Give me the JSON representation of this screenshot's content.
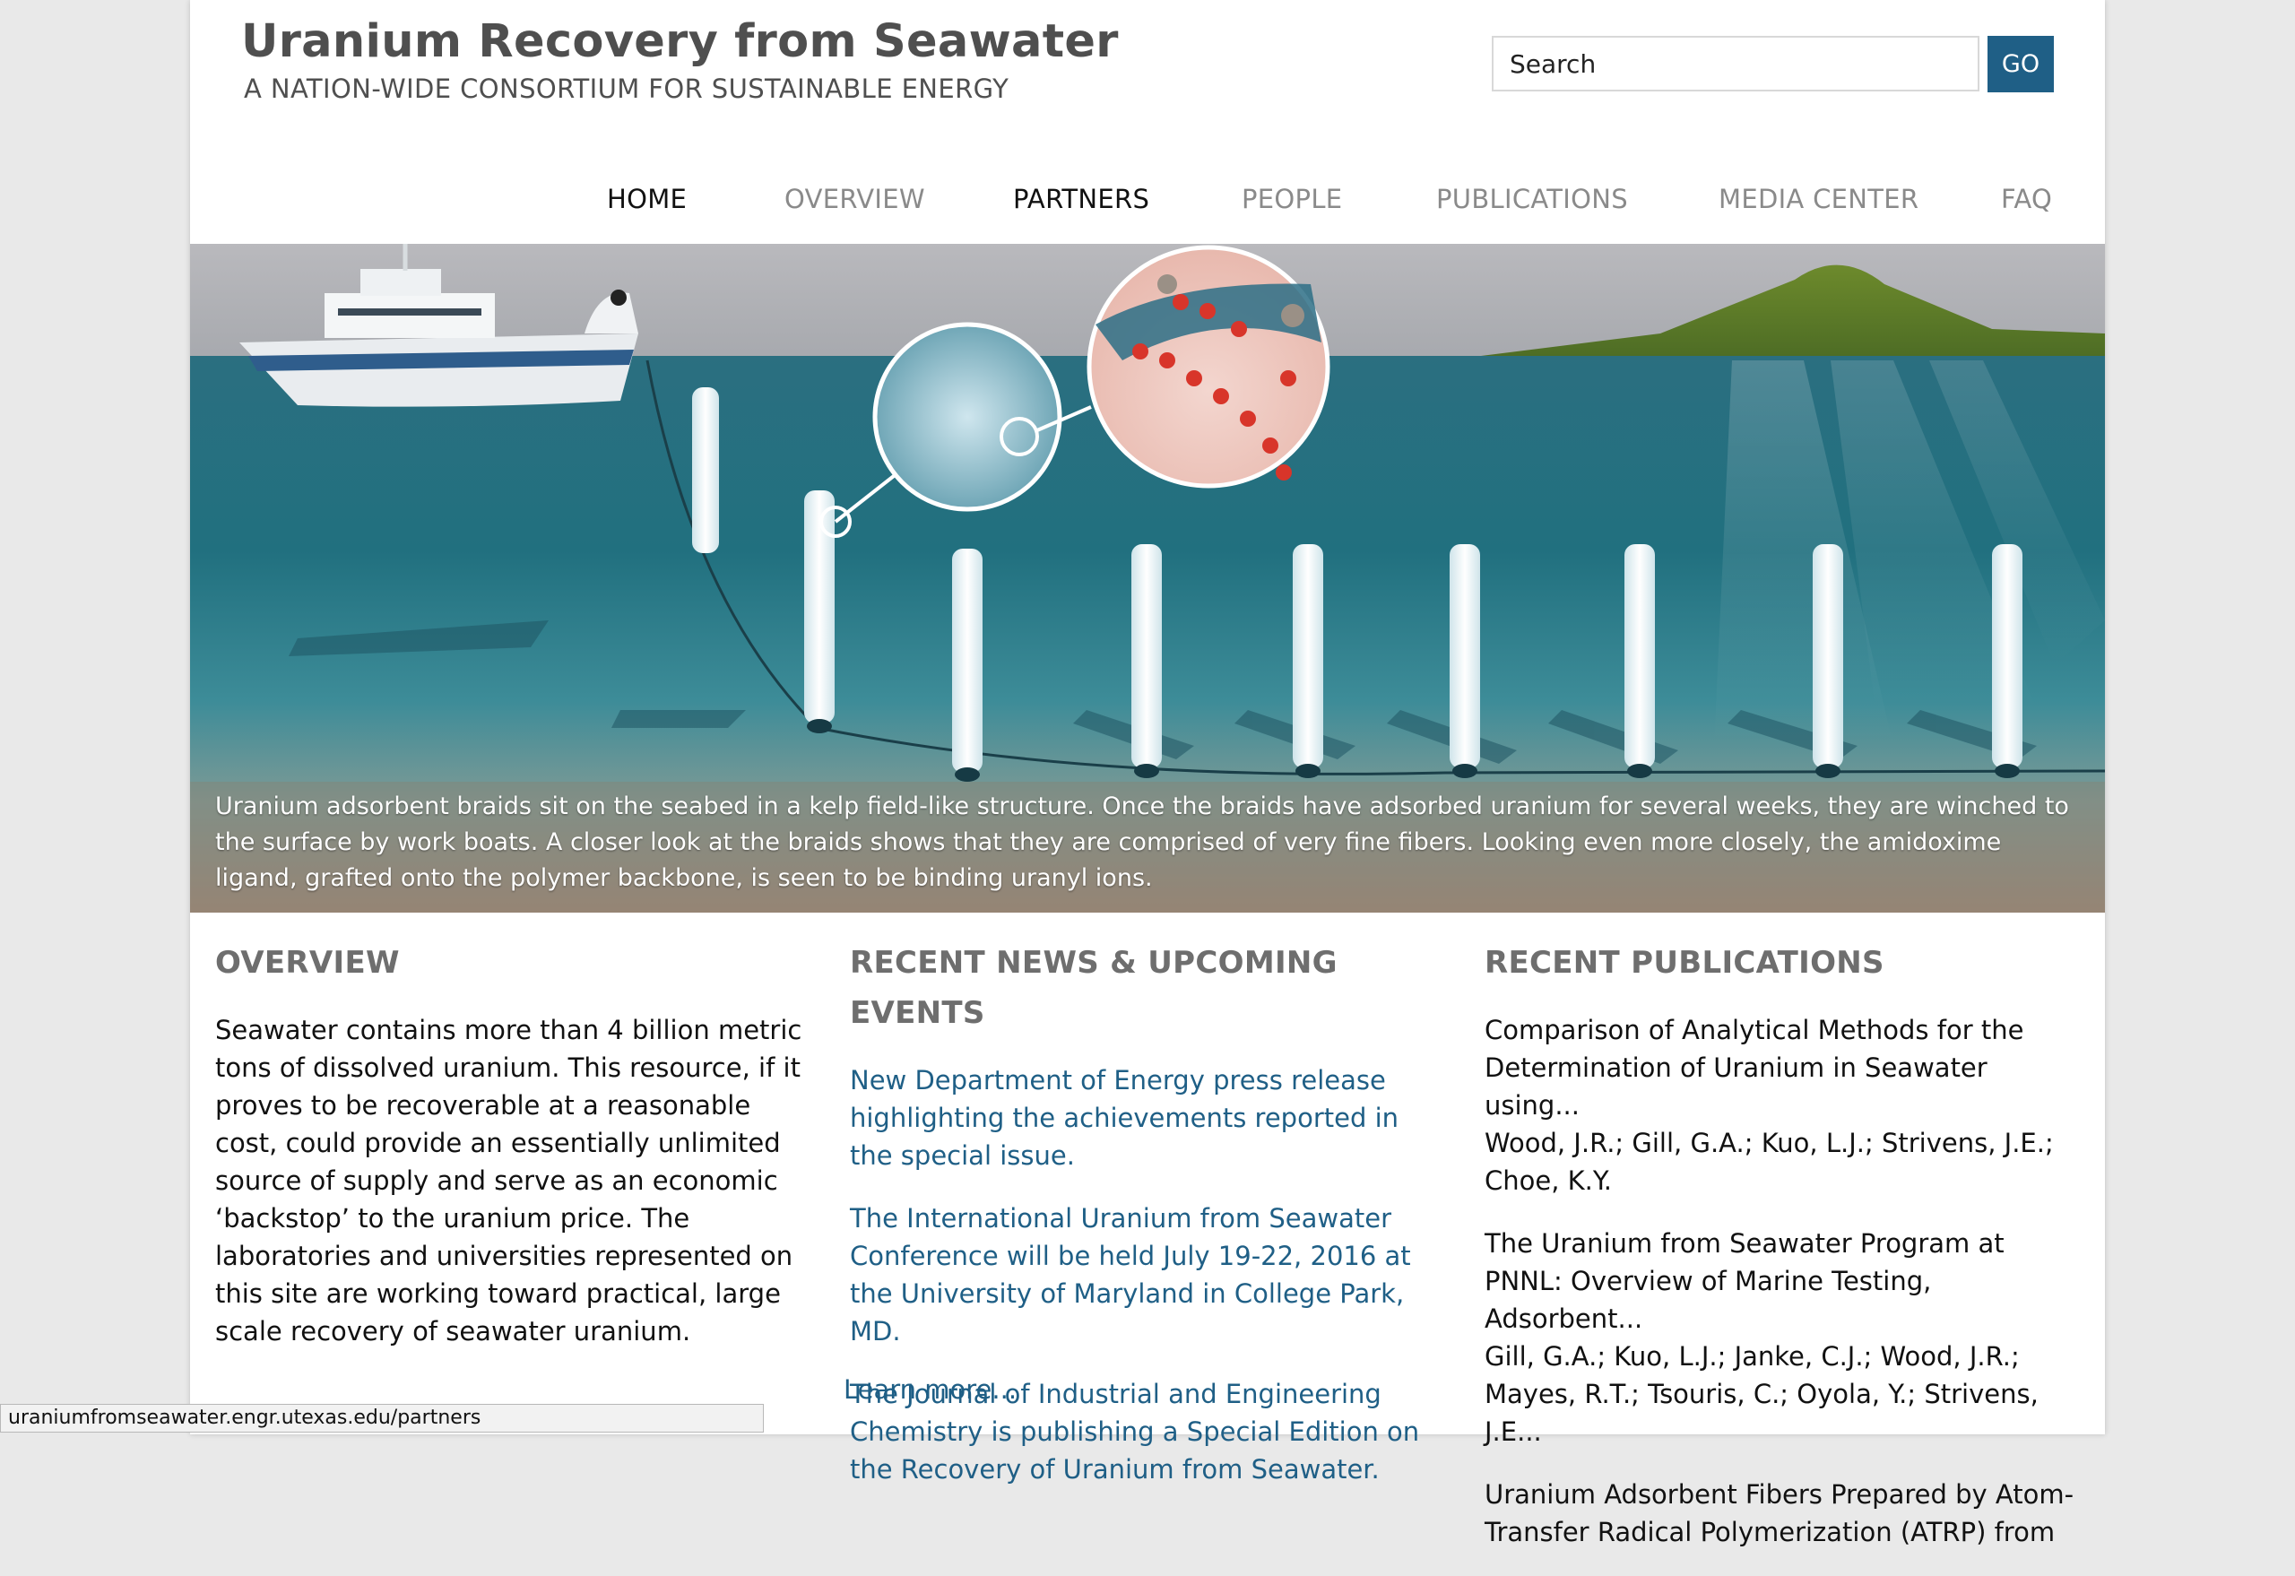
{
  "header": {
    "title": "Uranium Recovery from Seawater",
    "tagline": "A NATION-WIDE CONSORTIUM FOR SUSTAINABLE ENERGY"
  },
  "search": {
    "value": "Search",
    "button_label": "GO"
  },
  "nav": {
    "items": [
      {
        "label": "HOME"
      },
      {
        "label": "OVERVIEW"
      },
      {
        "label": "PARTNERS"
      },
      {
        "label": "PEOPLE"
      },
      {
        "label": "PUBLICATIONS"
      },
      {
        "label": "MEDIA CENTER"
      },
      {
        "label": "FAQ"
      }
    ]
  },
  "hero": {
    "caption": "Uranium adsorbent braids sit on the seabed in a kelp field-like structure.  Once the braids have adsorbed uranium for several weeks, they are winched to the surface by work boats.  A closer look at the braids shows that they are comprised of very fine fibers.  Looking even more closely, the amidoxime ligand, grafted onto the polymer backbone, is seen to be binding uranyl ions."
  },
  "overview": {
    "heading": "OVERVIEW",
    "text": "Seawater contains more than 4 billion metric tons of dissolved uranium. This resource, if it proves to be recoverable at a reasonable cost, could provide an essentially unlimited source of supply and serve as an economic ‘backstop’ to the uranium price. The laboratories and universities represented on this site are working toward practical, large scale recovery of seawater uranium.",
    "learn_more": "Learn more..."
  },
  "news": {
    "heading": "RECENT NEWS & UPCOMING EVENTS",
    "items": [
      {
        "text": "New Department of Energy press release highlighting the achievements reported in the special issue."
      },
      {
        "text": "The International Uranium from Seawater Conference will be held  July 19-22, 2016 at the University of Maryland in College Park, MD."
      },
      {
        "text": "The Journal of Industrial and Engineering Chemistry is publishing a Special Edition on the Recovery of Uranium from Seawater."
      }
    ]
  },
  "publications": {
    "heading": "RECENT PUBLICATIONS",
    "items": [
      {
        "title": "Comparison of Analytical Methods for the Determination of Uranium in Seawater using...",
        "authors": "Wood, J.R.; Gill, G.A.; Kuo, L.J.; Strivens, J.E.; Choe, K.Y."
      },
      {
        "title": "The Uranium from Seawater Program at PNNL: Overview of Marine Testing, Adsorbent...",
        "authors": "Gill, G.A.; Kuo, L.J.; Janke, C.J.; Wood, J.R.; Mayes, R.T.; Tsouris, C.; Oyola, Y.; Strivens, J.E..."
      },
      {
        "title": "Uranium Adsorbent Fibers Prepared by Atom-Transfer Radical Polymerization (ATRP) from",
        "authors": ""
      }
    ]
  },
  "status_bar": {
    "url": "uraniumfromseawater.engr.utexas.edu/partners"
  },
  "colors": {
    "accent": "#1f5f86",
    "heading_gray": "#6e6e6e",
    "title_gray": "#4f4f4f",
    "nav_gray": "#8a8a8a"
  }
}
